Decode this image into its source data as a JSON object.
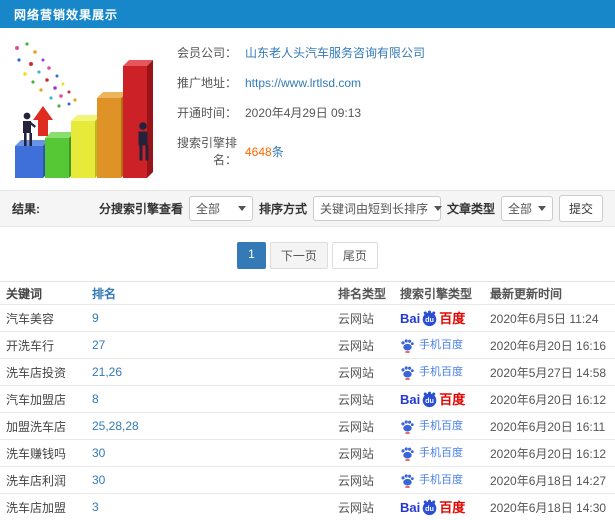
{
  "header": {
    "title": "网络营销效果展示"
  },
  "info": {
    "fields": [
      {
        "label": "会员公司：",
        "value": "山东老人头汽车服务咨询有限公司"
      },
      {
        "label": "推广地址：",
        "value": "https://www.lrtlsd.com"
      },
      {
        "label": "开通时间：",
        "value": "2020年4月29日 09:13"
      },
      {
        "label": "搜索引擎排名：",
        "value": "4648",
        "suffix": "条"
      }
    ]
  },
  "filters": {
    "result_label": "结果:",
    "engine_label": "分搜索引擎查看",
    "engine_value": "全部",
    "sort_label": "排序方式",
    "sort_value": "关键词由短到长排序",
    "article_label": "文章类型",
    "article_value": "全部",
    "submit_label": "提交"
  },
  "pagination": {
    "current": "1",
    "next": "下一页",
    "last": "尾页"
  },
  "table": {
    "headers": [
      "关键词",
      "排名",
      "排名类型",
      "搜索引擎类型",
      "最新更新时间"
    ],
    "engine_labels": {
      "baidu": {
        "bai": "Bai",
        "du": "du",
        "cn": "百度"
      },
      "mobile": "手机百度"
    },
    "rows": [
      {
        "keyword": "汽车美容",
        "rank": "9",
        "rank_type": "云网站",
        "engine": "baidu",
        "updated": "2020年6月5日 11:24"
      },
      {
        "keyword": "开洗车行",
        "rank": "27",
        "rank_type": "云网站",
        "engine": "mobile",
        "updated": "2020年6月20日 16:16"
      },
      {
        "keyword": "洗车店投资",
        "rank": "21,26",
        "rank_type": "云网站",
        "engine": "mobile",
        "updated": "2020年5月27日 14:58"
      },
      {
        "keyword": "汽车加盟店",
        "rank": "8",
        "rank_type": "云网站",
        "engine": "baidu",
        "updated": "2020年6月20日 16:12"
      },
      {
        "keyword": "加盟洗车店",
        "rank": "25,28,28",
        "rank_type": "云网站",
        "engine": "mobile",
        "updated": "2020年6月20日 16:11"
      },
      {
        "keyword": "洗车赚钱吗",
        "rank": "30",
        "rank_type": "云网站",
        "engine": "mobile",
        "updated": "2020年6月20日 16:12"
      },
      {
        "keyword": "洗车店利润",
        "rank": "30",
        "rank_type": "云网站",
        "engine": "mobile",
        "updated": "2020年6月18日 14:27"
      },
      {
        "keyword": "洗车店加盟",
        "rank": "3",
        "rank_type": "云网站",
        "engine": "baidu",
        "updated": "2020年6月18日 14:30"
      }
    ]
  },
  "colors": {
    "header_blue": "#1787c9",
    "link_blue": "#337ab7",
    "highlight_orange": "#ff6600",
    "baidu_blue": "#2439d2",
    "baidu_red": "#e10601",
    "filter_bg": "#f5f5f5"
  }
}
